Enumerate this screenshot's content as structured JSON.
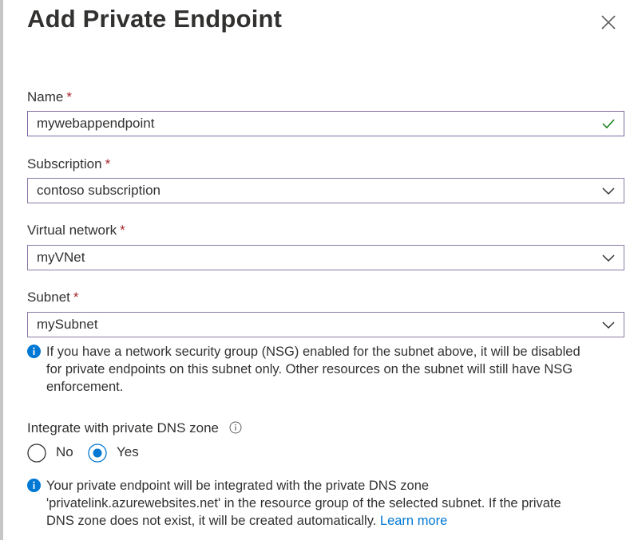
{
  "panel": {
    "title": "Add Private Endpoint"
  },
  "fields": {
    "name": {
      "label": "Name",
      "required_mark": "*",
      "value": "mywebappendpoint",
      "status_icon": "checkmark-icon"
    },
    "subscription": {
      "label": "Subscription",
      "required_mark": "*",
      "value": "contoso subscription",
      "icon": "chevron-down-icon"
    },
    "virtual_network": {
      "label": "Virtual network",
      "required_mark": "*",
      "value": "myVNet",
      "icon": "chevron-down-icon"
    },
    "subnet": {
      "label": "Subnet",
      "required_mark": "*",
      "value": "mySubnet",
      "icon": "chevron-down-icon"
    }
  },
  "nsg_info": {
    "line1": "If you have a network security group (NSG) enabled for the subnet above, it will be disabled",
    "line2": "for private endpoints on this subnet only. Other resources on the subnet will still have NSG",
    "line3": "enforcement."
  },
  "dns": {
    "label": "Integrate with private DNS zone",
    "options": [
      {
        "label": "No",
        "selected": false
      },
      {
        "label": "Yes",
        "selected": true
      }
    ]
  },
  "dns_info": {
    "line1": "Your private endpoint will be integrated with the private DNS zone",
    "line2": "'privatelink.azurewebsites.net' in the resource group of the selected subnet. If the private",
    "line3_prefix": "DNS zone does not exist, it will be created automatically.",
    "link": "Learn more"
  },
  "colors": {
    "accent": "#0078d4",
    "required": "#a4262c",
    "valid_check": "#107c10",
    "field_border": "#8a7aa6",
    "text": "#323130"
  }
}
